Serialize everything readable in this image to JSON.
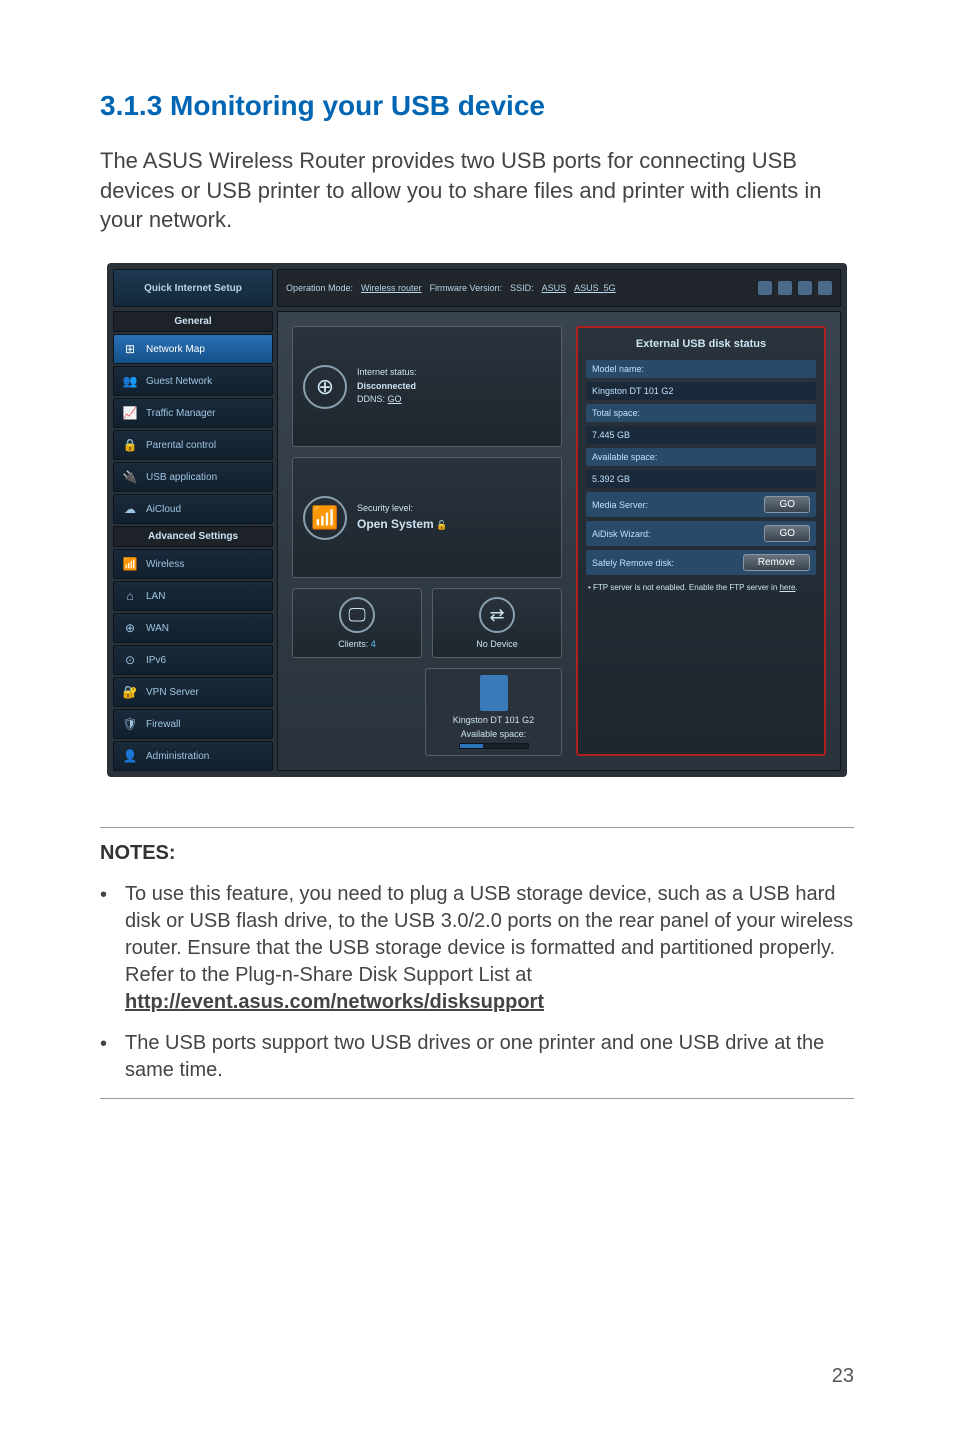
{
  "heading": "3.1.3 Monitoring your USB device",
  "intro": "The ASUS Wireless Router provides two USB ports for connecting USB devices or USB printer to allow you to share files and printer with clients in your network.",
  "notes_label": "NOTES:",
  "notes": [
    {
      "text_a": "To use this feature, you need to plug a USB storage device, such as a USB hard disk or USB flash drive, to the USB 3.0/2.0 ports on the rear panel of your wireless router. Ensure that the USB storage device is formatted and partitioned properly. Refer to the Plug-n-Share Disk Support List at ",
      "link": "http://event.asus.com/networks/disksupport"
    },
    {
      "text_a": "The USB ports support two USB drives or one printer and one USB drive at the same time."
    }
  ],
  "page_number": "23",
  "router_ui": {
    "qis": "Quick Internet Setup",
    "topbar": {
      "op_mode_label": "Operation Mode:",
      "op_mode": "Wireless router",
      "fw_label": "Firmware Version:",
      "ssid_label": "SSID:",
      "ssid1": "ASUS",
      "ssid2": "ASUS_5G"
    },
    "sidebar": {
      "general": "General",
      "items_g": [
        {
          "icon": "⊞",
          "label": "Network Map",
          "active": true
        },
        {
          "icon": "👥",
          "label": "Guest Network"
        },
        {
          "icon": "📈",
          "label": "Traffic Manager"
        },
        {
          "icon": "🔒",
          "label": "Parental control"
        },
        {
          "icon": "🔌",
          "label": "USB application"
        },
        {
          "icon": "☁",
          "label": "AiCloud"
        }
      ],
      "advanced": "Advanced Settings",
      "items_a": [
        {
          "icon": "📶",
          "label": "Wireless"
        },
        {
          "icon": "⌂",
          "label": "LAN"
        },
        {
          "icon": "⊕",
          "label": "WAN"
        },
        {
          "icon": "⊙",
          "label": "IPv6"
        },
        {
          "icon": "🔐",
          "label": "VPN Server"
        },
        {
          "icon": "🛡",
          "label": "Firewall"
        },
        {
          "icon": "👤",
          "label": "Administration"
        }
      ]
    },
    "cards": {
      "internet": {
        "l1": "Internet status:",
        "l2": "Disconnected",
        "l3": "DDNS:",
        "l4": "GO"
      },
      "security": {
        "l1": "Security level:",
        "l2": "Open System"
      },
      "clients": {
        "label": "Clients:",
        "count": "4"
      },
      "nodevice": "No Device",
      "usb": {
        "name": "Kingston DT 101 G2",
        "avail": "Available space:"
      }
    },
    "right": {
      "title": "External USB disk status",
      "rows": [
        {
          "k": "Model name:"
        },
        {
          "v": "Kingston DT 101 G2"
        },
        {
          "k": "Total space:"
        },
        {
          "v": "7.445 GB"
        },
        {
          "k": "Available space:"
        },
        {
          "v": "5.392 GB"
        },
        {
          "k": "Media Server:",
          "btn": "GO"
        },
        {
          "k": "AiDisk Wizard:",
          "btn": "GO"
        },
        {
          "k": "Safely Remove disk:",
          "btn": "Remove"
        }
      ],
      "note_lead": "• FTP server is not enabled. Enable the FTP server in ",
      "note_link": "here"
    }
  }
}
